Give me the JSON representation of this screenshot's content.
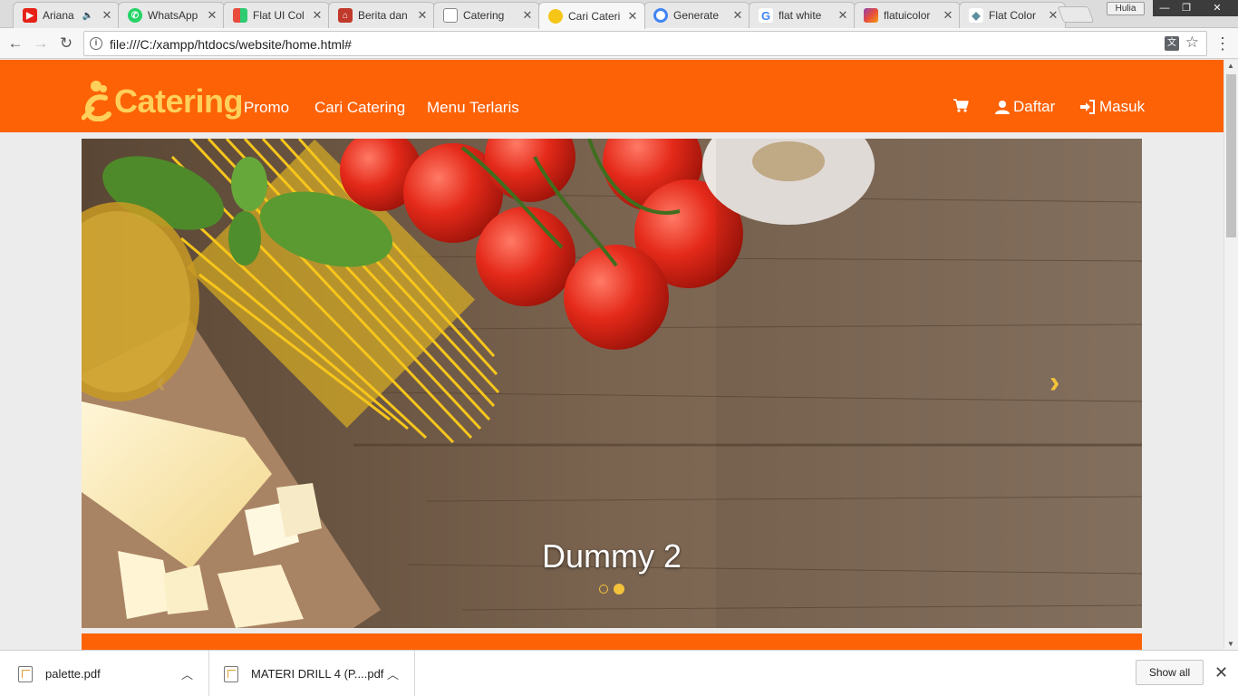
{
  "browser": {
    "tabs": [
      {
        "title": "Ariana",
        "icon": "youtube-icon",
        "color": "#e62117",
        "audio": true
      },
      {
        "title": "WhatsApp",
        "icon": "whatsapp-icon",
        "color": "#25d366"
      },
      {
        "title": "Flat UI Col",
        "icon": "flatui-icon",
        "color": "#9b59b6"
      },
      {
        "title": "Berita dan",
        "icon": "news-icon",
        "color": "#c0392b"
      },
      {
        "title": "Catering",
        "icon": "page-icon",
        "color": "#888888"
      },
      {
        "title": "Cari Cateri",
        "icon": "catering-icon",
        "color": "#f5c518",
        "active": true
      },
      {
        "title": "Generate",
        "icon": "generate-icon",
        "color": "#4285f4"
      },
      {
        "title": "flat white",
        "icon": "google-icon",
        "color": "#4285f4"
      },
      {
        "title": "flatuicolor",
        "icon": "flatuicolors-icon",
        "color": "#8e44ad"
      },
      {
        "title": "Flat Color",
        "icon": "diamond-icon",
        "color": "#5e8f9e"
      }
    ],
    "profile_label": "Hulia",
    "url": "file:///C:/xampp/htdocs/website/home.html#"
  },
  "site": {
    "brand": "Catering",
    "nav": [
      "Promo",
      "Cari Catering",
      "Menu Terlaris"
    ],
    "daftar": "Daftar",
    "masuk": "Masuk",
    "accent": "#fd6207",
    "brand_color": "#ffd05a"
  },
  "carousel": {
    "caption": "Dummy 2",
    "slides_count": 2,
    "active_slide": 2
  },
  "downloads": {
    "items": [
      "palette.pdf",
      "MATERI DRILL 4 (P....pdf"
    ],
    "show_all": "Show all"
  }
}
